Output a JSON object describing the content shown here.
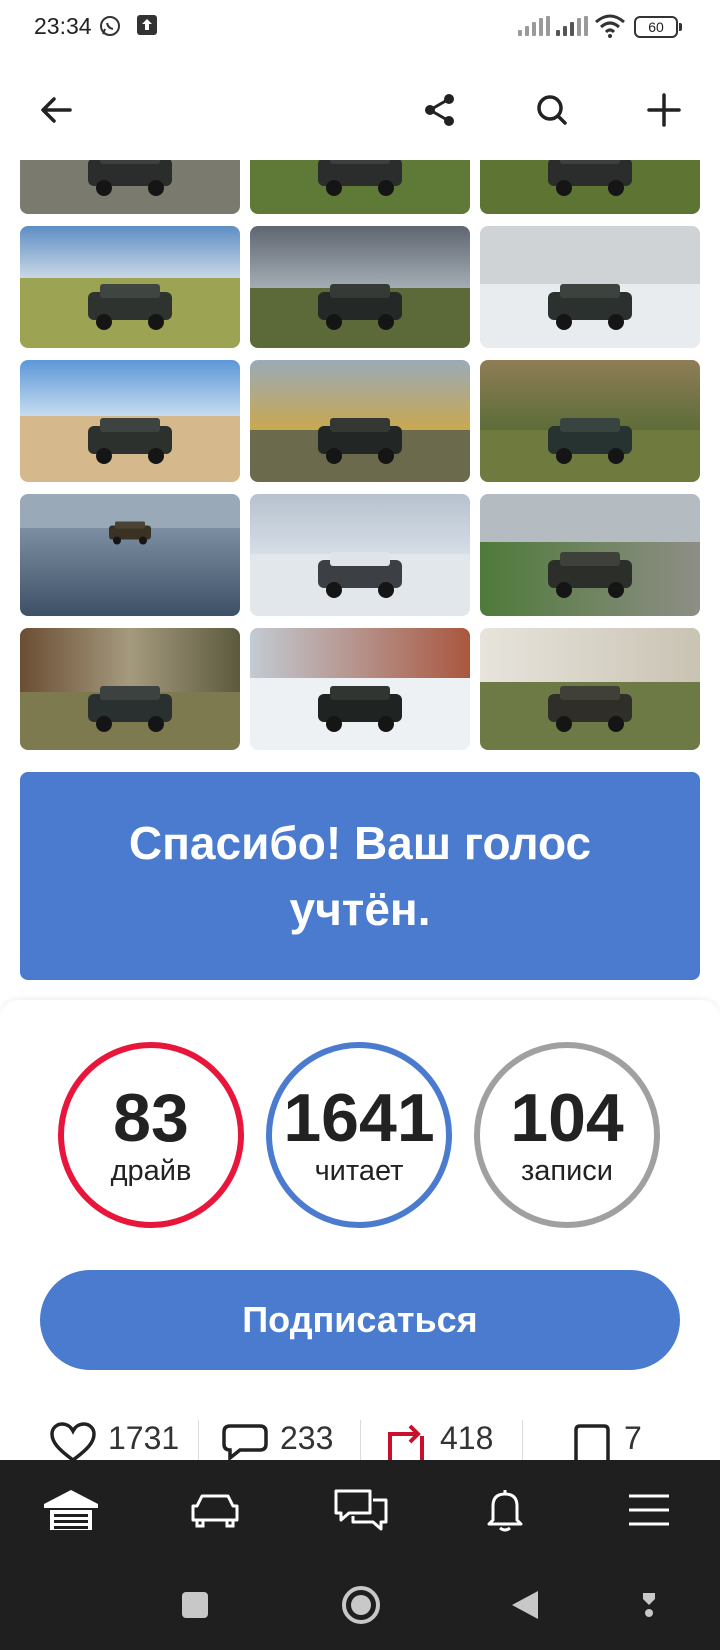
{
  "status_bar": {
    "time": "23:34",
    "battery": "60",
    "icons": [
      "whatsapp-icon",
      "upload-icon",
      "signal-icon",
      "signal-icon",
      "wifi-icon",
      "battery-icon"
    ]
  },
  "header": {
    "icons": [
      "back-arrow-icon",
      "share-icon",
      "search-icon",
      "plus-icon"
    ]
  },
  "vote_banner": {
    "text": "Спасибо! Ваш голос учтён."
  },
  "stats": [
    {
      "value": "83",
      "label": "драйв",
      "color": "#e8163a"
    },
    {
      "value": "1641",
      "label": "читает",
      "color": "#4a7bcf"
    },
    {
      "value": "104",
      "label": "записи",
      "color": "#a0a0a0"
    }
  ],
  "subscribe_label": "Подписаться",
  "counters": [
    {
      "icon": "heart-icon",
      "value": "1731"
    },
    {
      "icon": "comment-icon",
      "value": "233"
    },
    {
      "icon": "repost-icon",
      "value": "418"
    },
    {
      "icon": "bookmark-icon",
      "value": "7"
    }
  ],
  "bottom_nav": [
    "garage-icon",
    "car-icon",
    "chat-icon",
    "bell-icon",
    "menu-icon"
  ],
  "colors": {
    "accent": "#4a7bcf",
    "drive_red": "#e8163a",
    "nav_bg": "#1f1f1f"
  }
}
